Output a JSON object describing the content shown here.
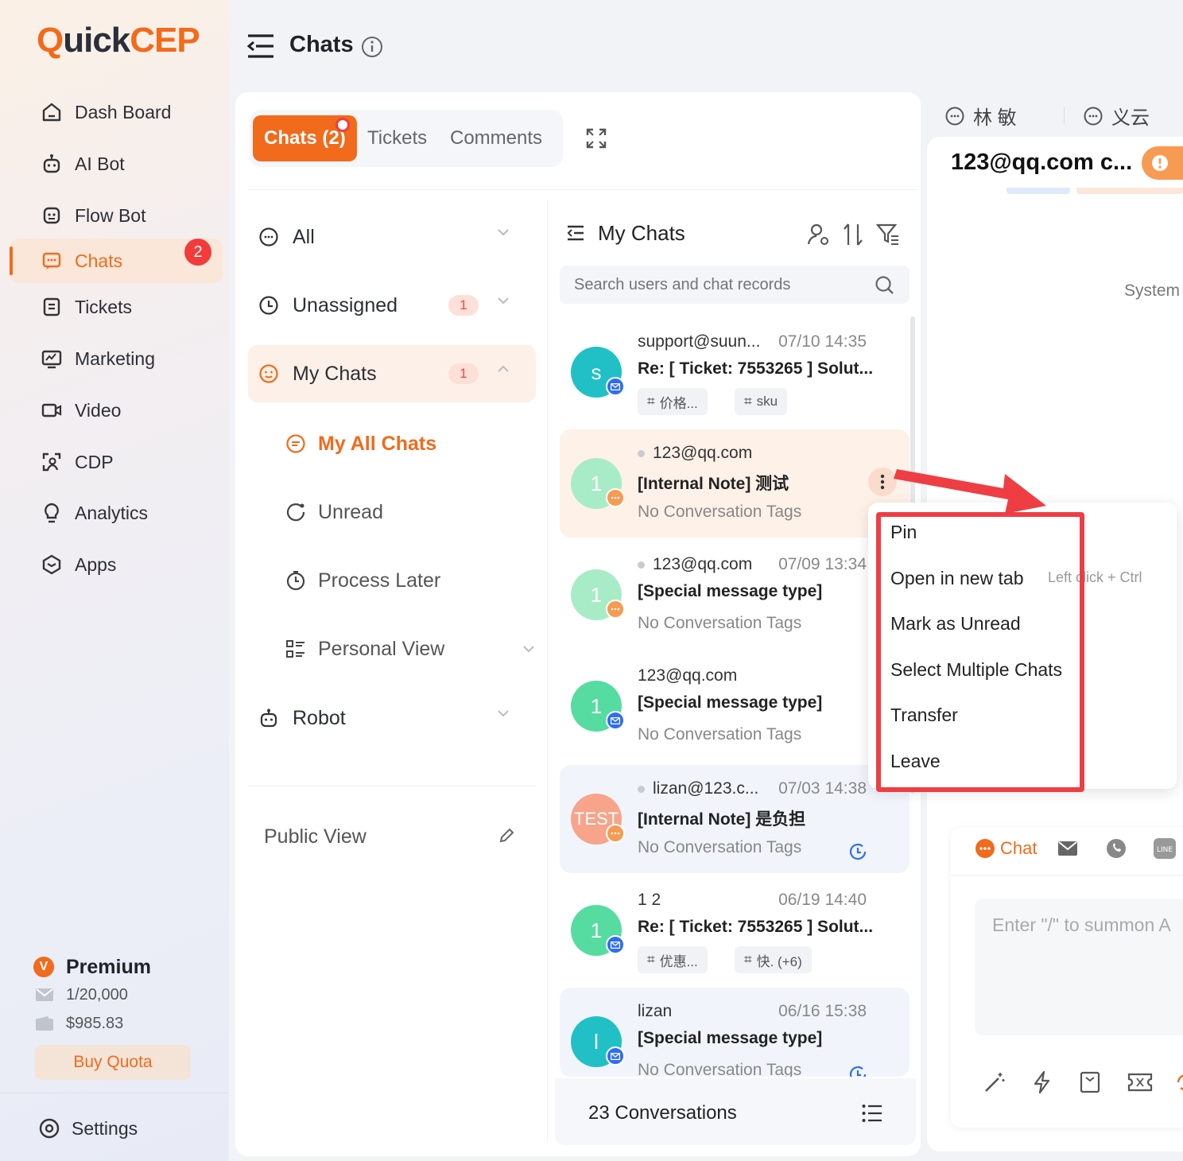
{
  "brand": {
    "logo_q": "Q",
    "logo_mid": "uick",
    "logo_end": "CEP"
  },
  "nav": {
    "dashboard": "Dash Board",
    "ai_bot": "AI Bot",
    "flow_bot": "Flow Bot",
    "chats": "Chats",
    "chats_badge": "2",
    "tickets": "Tickets",
    "marketing": "Marketing",
    "video": "Video",
    "cdp": "CDP",
    "analytics": "Analytics",
    "apps": "Apps"
  },
  "plan": {
    "name": "Premium",
    "quota": "1/20,000",
    "balance": "$985.83",
    "buy": "Buy Quota"
  },
  "settings": "Settings",
  "header": {
    "title": "Chats"
  },
  "tabs": {
    "chats": "Chats (2)",
    "tickets": "Tickets",
    "comments": "Comments"
  },
  "filters": {
    "all": "All",
    "unassigned": "Unassigned",
    "unassigned_count": "1",
    "my_chats": "My Chats",
    "my_chats_count": "1",
    "my_all_chats": "My All Chats",
    "unread": "Unread",
    "process_later": "Process Later",
    "personal_view": "Personal View",
    "robot": "Robot",
    "public_view": "Public View"
  },
  "list": {
    "title": "My Chats",
    "search_placeholder": "Search users and chat records",
    "footer": "23 Conversations",
    "items": [
      {
        "avatar": "s",
        "name": "support@suun...",
        "time": "07/10 14:35",
        "msg": "Re: [ Ticket: 7553265 ] Solut...",
        "tag1": "价格...",
        "tag2": "sku"
      },
      {
        "avatar": "1",
        "name": "123@qq.com",
        "time": "",
        "msg": "[Internal Note] 测试",
        "tags": "No Conversation Tags"
      },
      {
        "avatar": "1",
        "name": "123@qq.com",
        "time": "07/09 13:34",
        "msg": "[Special message type]",
        "tags": "No Conversation Tags"
      },
      {
        "avatar": "1",
        "name": "123@qq.com",
        "time": "",
        "msg": "[Special message type]",
        "tags": "No Conversation Tags"
      },
      {
        "avatar": "TEST",
        "name": "lizan@123.c...",
        "time": "07/03 14:38",
        "msg": "[Internal Note] 是负担",
        "tags": "No Conversation Tags"
      },
      {
        "avatar": "1",
        "name": "1 2",
        "time": "06/19 14:40",
        "msg": "Re: [ Ticket: 7553265 ] Solut...",
        "tag1": "优惠...",
        "tag2": "快. (+6)"
      },
      {
        "avatar": "l",
        "name": "lizan",
        "time": "06/16 15:38",
        "msg": "[Special message type]",
        "tags": "No Conversation Tags"
      }
    ]
  },
  "menu": {
    "pin": "Pin",
    "open_tab": "Open in new tab",
    "open_tab_hint": "Left click + Ctrl",
    "mark_unread": "Mark as Unread",
    "select_multi": "Select Multiple Chats",
    "transfer": "Transfer",
    "leave": "Leave"
  },
  "right": {
    "tab1": "林 敏",
    "tab2": "义云",
    "title": "123@qq.com c...",
    "system": "System",
    "chat_label": "Chat",
    "input_placeholder": "Enter \"/\" to summon A"
  },
  "colors": {
    "accent": "#f26a1b",
    "danger": "#ee3e44",
    "teal": "#21c0c6",
    "green": "#56dca0"
  }
}
